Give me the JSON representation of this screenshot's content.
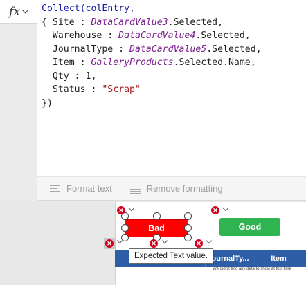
{
  "formula_bar": {
    "fx_label": "fx",
    "code_lines": [
      [
        {
          "t": "Collect(",
          "c": "fn"
        },
        {
          "t": "colEntry,",
          "c": "fn"
        }
      ],
      [
        {
          "t": "{ Site : ",
          "c": "id"
        },
        {
          "t": "DataCardValue3",
          "c": "var"
        },
        {
          "t": ".Selected,",
          "c": "id"
        }
      ],
      [
        {
          "t": "  Warehouse : ",
          "c": "id"
        },
        {
          "t": "DataCardValue4",
          "c": "var"
        },
        {
          "t": ".Selected,",
          "c": "id"
        }
      ],
      [
        {
          "t": "  JournalType : ",
          "c": "id"
        },
        {
          "t": "DataCardValue5",
          "c": "var"
        },
        {
          "t": ".Selected,",
          "c": "id"
        }
      ],
      [
        {
          "t": "  Item : ",
          "c": "id"
        },
        {
          "t": "GalleryProducts",
          "c": "var"
        },
        {
          "t": ".Selected.Name,",
          "c": "id"
        }
      ],
      [
        {
          "t": "  Qty : ",
          "c": "id"
        },
        {
          "t": "1",
          "c": "num"
        },
        {
          "t": ",",
          "c": "id"
        }
      ],
      [
        {
          "t": "  Status : ",
          "c": "id"
        },
        {
          "t": "\"Scrap\"",
          "c": "str"
        }
      ],
      [
        {
          "t": "})",
          "c": "id"
        }
      ]
    ]
  },
  "toolbar": {
    "format_text": "Format text",
    "remove_formatting": "Remove formatting"
  },
  "canvas": {
    "bad_button": "Bad",
    "good_button": "Good",
    "table_headers": [
      "JournalTy...",
      "Item"
    ],
    "no_data_text": "We didn't find any data to show at this time",
    "tooltip": "Expected Text value."
  },
  "colors": {
    "bad": "#ff0000",
    "good": "#2fb451",
    "table_header": "#2e5fa6",
    "error": "#d4001d"
  }
}
